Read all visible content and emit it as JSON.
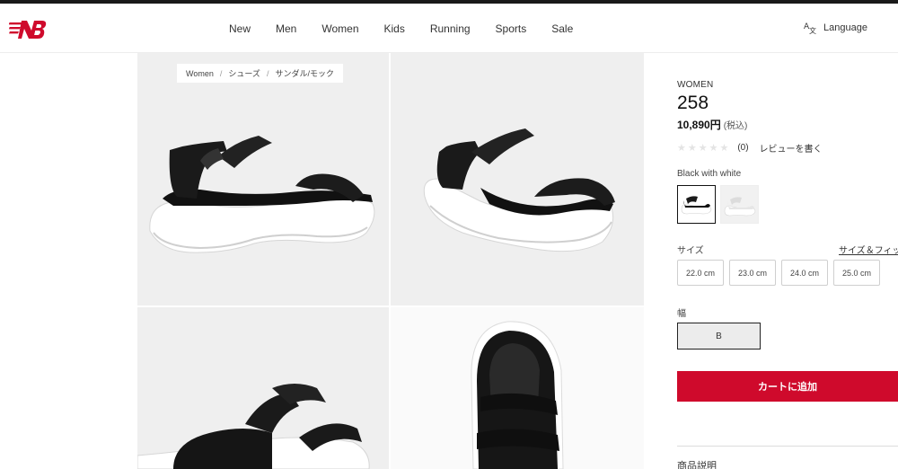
{
  "brand": {
    "logo_icon": "new-balance-logo",
    "accent": "#cf0a2c"
  },
  "nav": {
    "items": [
      "New",
      "Men",
      "Women",
      "Kids",
      "Running",
      "Sports",
      "Sale"
    ],
    "language": {
      "icon": "translate-icon",
      "label": "Language"
    }
  },
  "breadcrumb": [
    "Women",
    "シューズ",
    "サンダル/モック"
  ],
  "product": {
    "category": "WOMEN",
    "name": "258",
    "price": "10,890円",
    "tax_note": "(税込)",
    "review_count": "(0)",
    "write_review": "レビューを書く",
    "color_name": "Black with white",
    "swatches": [
      "Black with white",
      "White"
    ],
    "size_label": "サイズ",
    "size_guide": "サイズ＆フィッ",
    "sizes": [
      "22.0 cm",
      "23.0 cm",
      "24.0 cm",
      "25.0 cm"
    ],
    "width_label": "幅",
    "width_value": "B",
    "add_to_cart": "カートに追加",
    "description_label": "商品説明"
  }
}
